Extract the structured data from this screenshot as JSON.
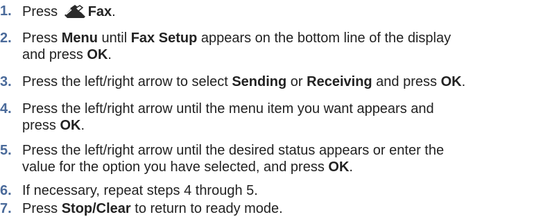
{
  "steps": [
    {
      "number": "1.",
      "p1": "Press ",
      "icon": "fax-icon",
      "b1": "Fax",
      "p2": "."
    },
    {
      "number": "2.",
      "p1": "Press ",
      "b1": "Menu",
      "p2": " until ",
      "b2": "Fax Setup",
      "p3": " appears on the bottom line of the display",
      "l2p1": "and press ",
      "l2b1": "OK",
      "l2p2": "."
    },
    {
      "number": "3.",
      "p1": "Press the left/right arrow to select ",
      "b1": "Sending",
      "p2": " or ",
      "b2": "Receiving",
      "p3": " and press ",
      "b3": "OK",
      "p4": "."
    },
    {
      "number": "4.",
      "p1": "Press the left/right arrow until the menu item you want appears and",
      "l2p1": "press ",
      "l2b1": "OK",
      "l2p2": "."
    },
    {
      "number": "5.",
      "p1": "Press the left/right arrow until the desired status appears or enter the",
      "l2p1": "value for the option you have selected, and press ",
      "l2b1": "OK",
      "l2p2": "."
    },
    {
      "number": "6.",
      "p1": "If necessary, repeat steps 4 through 5."
    },
    {
      "number": "7.",
      "p1": "Press ",
      "b1": "Stop/Clear",
      "p2": " to return to ready mode."
    }
  ]
}
